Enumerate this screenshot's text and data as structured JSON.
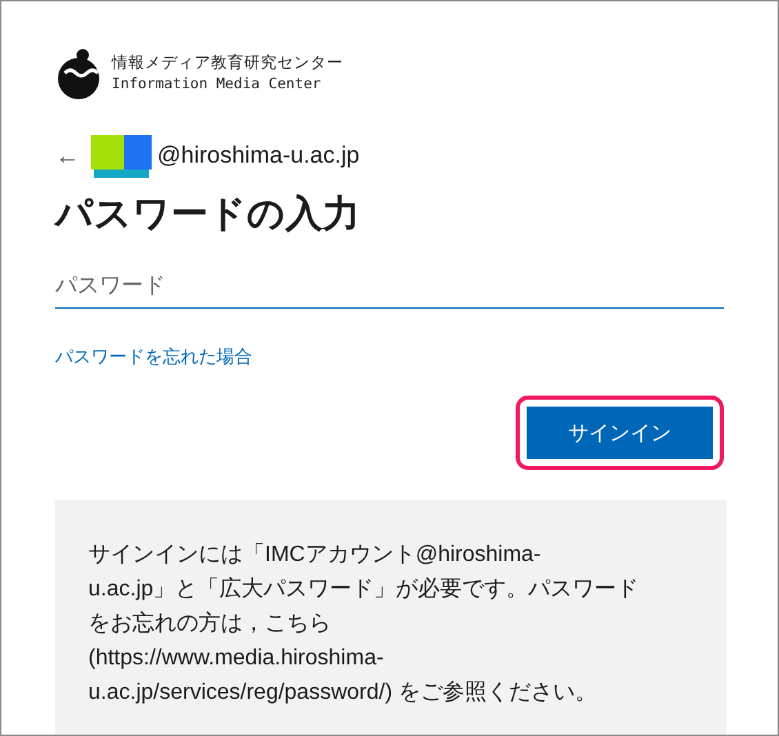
{
  "logo": {
    "name_ja": "情報メディア教育研究センター",
    "name_en": "Information Media Center"
  },
  "account": {
    "back_icon": "←",
    "email": "@hiroshima-u.ac.jp",
    "redacted": true
  },
  "title": "パスワードの入力",
  "password_field": {
    "placeholder": "パスワード"
  },
  "forgot_link": "パスワードを忘れた場合",
  "sign_in_button": {
    "label": "サインイン",
    "highlighted": true
  },
  "info_lines": [
    "サインインには「IMCアカウント@hiroshima-",
    "u.ac.jp」と「広大パスワード」が必要です。パスワード",
    "をお忘れの方は，こちら",
    "(https://www.media.hiroshima-",
    "u.ac.jp/services/reg/password/) をご参照ください。"
  ]
}
